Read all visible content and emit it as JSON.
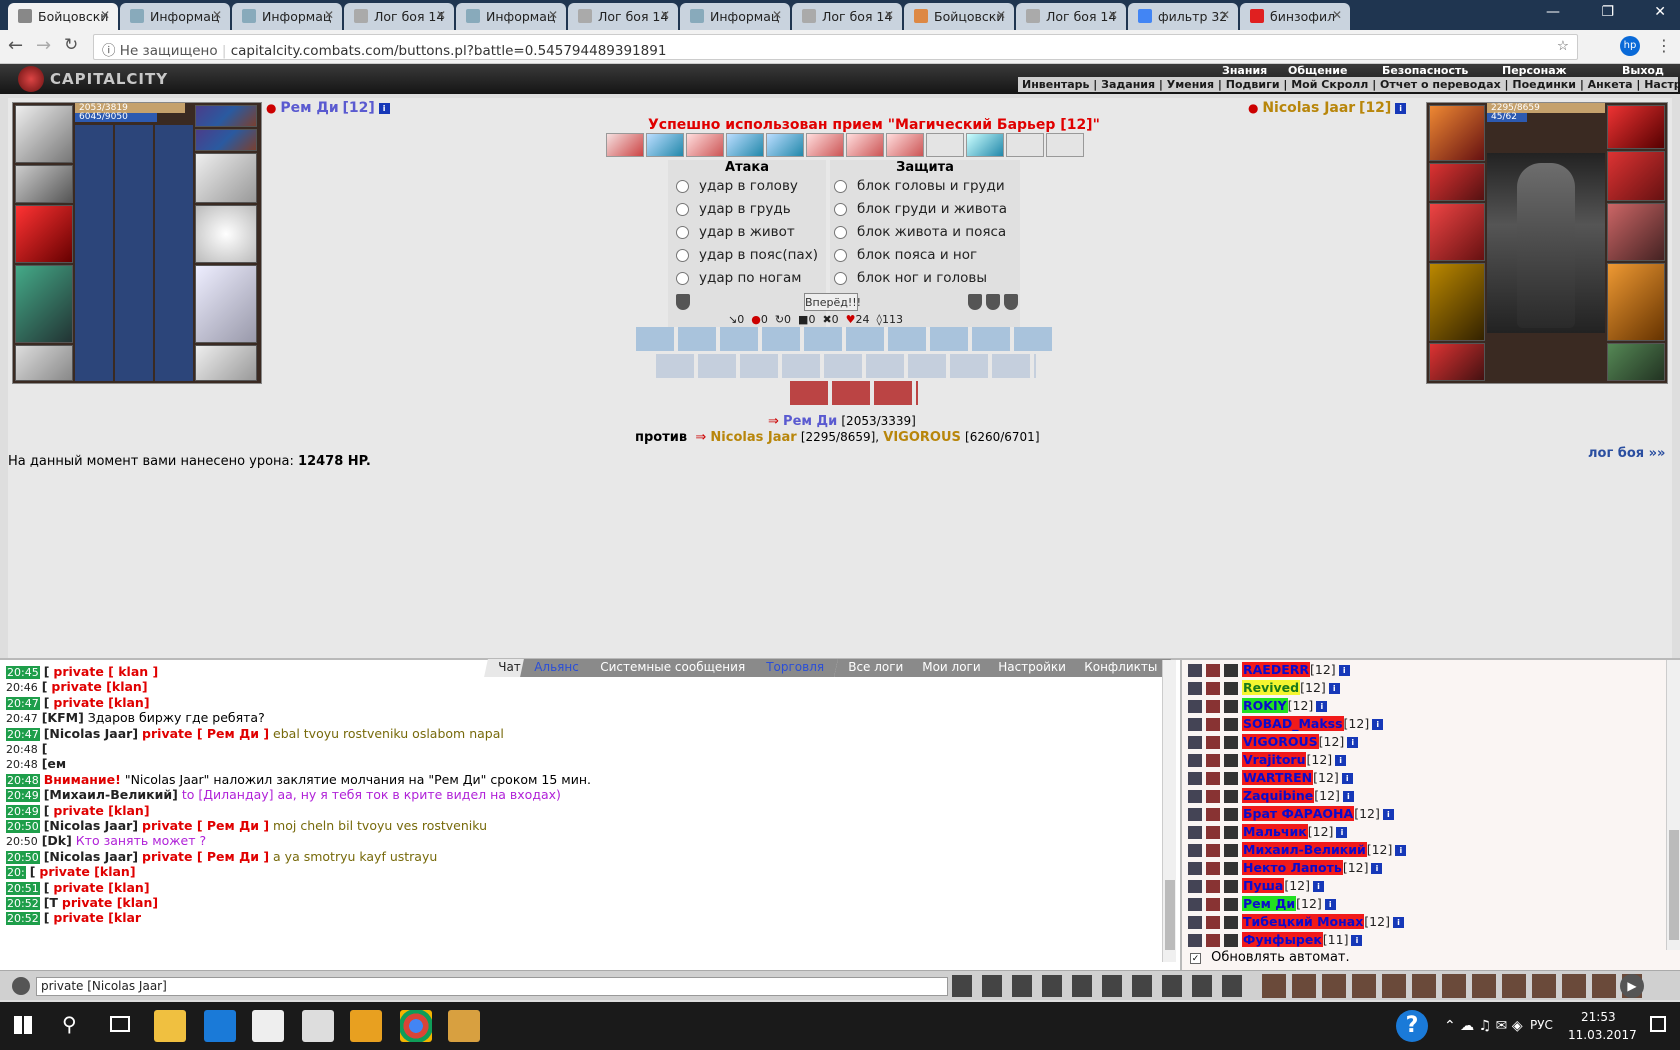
{
  "browser": {
    "tabs": [
      {
        "label": "Бойцовски",
        "active": true
      },
      {
        "label": "Информац"
      },
      {
        "label": "Информац"
      },
      {
        "label": "Лог боя 14"
      },
      {
        "label": "Информац"
      },
      {
        "label": "Лог боя 14"
      },
      {
        "label": "Информац"
      },
      {
        "label": "Лог боя 14"
      },
      {
        "label": "Бойцовски"
      },
      {
        "label": "Лог боя 14"
      },
      {
        "label": "фильтр 32"
      },
      {
        "label": "бинзофил"
      }
    ],
    "security_label": "Не защищено",
    "url": "capitalcity.combats.com/buttons.pl?battle=0.545794489391891"
  },
  "game_header": {
    "logo": "CAPITALCITY",
    "top_menu": [
      "Знания",
      "Общение",
      "Безопасность",
      "Персонаж",
      "Выход"
    ],
    "sub_menu": [
      "Инвентарь",
      "Задания",
      "Умения",
      "Подвиги",
      "Мой Скролл",
      "Отчет о переводах",
      "Поединки",
      "Анкета",
      "Настройки"
    ]
  },
  "battle": {
    "player": {
      "name": "Рем Ди",
      "level": "[12]",
      "hp": "2053/3819",
      "mp": "6045/9050"
    },
    "enemy": {
      "name": "Nicolas Jaar",
      "level": "[12]",
      "hp": "2295/8659",
      "mp": "45/62"
    },
    "status_message": "Успешно использован прием \"Магический Барьер [12]\"",
    "attack": {
      "title": "Атака",
      "options": [
        "удар в голову",
        "удар в грудь",
        "удар в живот",
        "удар в пояс(пах)",
        "удар по ногам"
      ]
    },
    "defense": {
      "title": "Защита",
      "options": [
        "блок головы и груди",
        "блок груди и живота",
        "блок живота и пояса",
        "блок пояса и ног",
        "блок ног и головы"
      ]
    },
    "go_button": "Вперёд!!!",
    "stats": [
      "0",
      "0",
      "0",
      "0",
      "0",
      "24",
      "113"
    ],
    "vs": {
      "player_name": "Рем Ди",
      "player_hp": "[2053/3339]",
      "against": "против",
      "enemy_name": "Nicolas Jaar",
      "enemy_hp": "[2295/8659],",
      "ally_name": "VIGOROUS",
      "ally_hp": "[6260/6701]"
    },
    "damage_text": "На данный момент вами нанесено урона:",
    "damage_value": "12478 HP.",
    "log_link": "лог боя »»"
  },
  "chat": {
    "tabs": [
      "Чат",
      "Альянс",
      "Системные сообщения",
      "Торговля",
      "Все логи",
      "Мои логи",
      "Настройки",
      "Конфликты"
    ],
    "lines": [
      {
        "time": "20:45",
        "name": "[",
        "text": "private [ klan ]"
      },
      {
        "time": "20:46",
        "name": "[",
        "text": "private [klan]"
      },
      {
        "time": "20:47",
        "name": "[",
        "text": "private [klan]"
      },
      {
        "time": "20:47",
        "name": "[KFM]",
        "text": "Здаров биржу где ребята?"
      },
      {
        "time": "20:47",
        "name": "[Nicolas Jaar]",
        "text": "private [ Рем Ди ]",
        "msg": "ebal tvoyu rostveniku oslabom napal"
      },
      {
        "time": "20:48",
        "name": "[",
        "text": ""
      },
      {
        "time": "20:48",
        "name": "[ем",
        "text": ""
      },
      {
        "time": "20:48",
        "name": "Внимание!",
        "text": "\"Nicolas Jaar\" наложил заклятие молчания на \"Рем Ди\" сроком 15 мин."
      },
      {
        "time": "20:49",
        "name": "[Михаил-Великий]",
        "text": "to [Диландау] аа, ну я тебя ток в крите видел на входах)"
      },
      {
        "time": "20:49",
        "name": "[",
        "text": "private [klan]"
      },
      {
        "time": "20:50",
        "name": "[Nicolas Jaar]",
        "text": "private [ Рем Ди ]",
        "msg": "moj cheln bil tvoyu ves rostveniku"
      },
      {
        "time": "20:50",
        "name": "[Dk]",
        "text": "Кто занять может ?"
      },
      {
        "time": "20:50",
        "name": "[Nicolas Jaar]",
        "text": "private [ Рем Ди ]",
        "msg": "a ya smotryu kayf ustrayu"
      },
      {
        "time": "20:",
        "name": "[",
        "text": "private [klan]"
      },
      {
        "time": "20:51",
        "name": "[",
        "text": "private [klan]"
      },
      {
        "time": "20:52",
        "name": "[T",
        "text": "private [klan]"
      },
      {
        "time": "20:52",
        "name": "[",
        "text": "private [klar"
      }
    ],
    "input_value": "private [Nicolas Jaar]"
  },
  "users": {
    "list": [
      {
        "name": "RAEDERR",
        "level": "[12]"
      },
      {
        "name": "Revived",
        "level": "[12]",
        "color": "yellow"
      },
      {
        "name": "ROKIY",
        "level": "[12]",
        "color": "green"
      },
      {
        "name": "SOBAD_Makss",
        "level": "[12]"
      },
      {
        "name": "VIGOROUS",
        "level": "[12]"
      },
      {
        "name": "Vrajitoru",
        "level": "[12]"
      },
      {
        "name": "WARTREN",
        "level": "[12]"
      },
      {
        "name": "Zaquibine",
        "level": "[12]"
      },
      {
        "name": "Брат ФАРАОНА",
        "level": "[12]"
      },
      {
        "name": "Мальчик",
        "level": "[12]"
      },
      {
        "name": "Михаил-Великий",
        "level": "[12]"
      },
      {
        "name": "Некто Лапоть",
        "level": "[12]"
      },
      {
        "name": "Пуша",
        "level": "[12]"
      },
      {
        "name": "Рем Ди",
        "level": "[12]",
        "color": "green"
      },
      {
        "name": "Тибецкий Монах",
        "level": "[12]"
      },
      {
        "name": "Фунфырек",
        "level": "[11]"
      }
    ],
    "auto_refresh_label": "Обновлять автомат."
  },
  "taskbar": {
    "time": "21:53",
    "date": "11.03.2017",
    "lang": "РУС"
  },
  "colors": {
    "accent_red": "#e00000",
    "user_bg_red": "#f11a1a",
    "user_bg_green": "#22e022"
  }
}
